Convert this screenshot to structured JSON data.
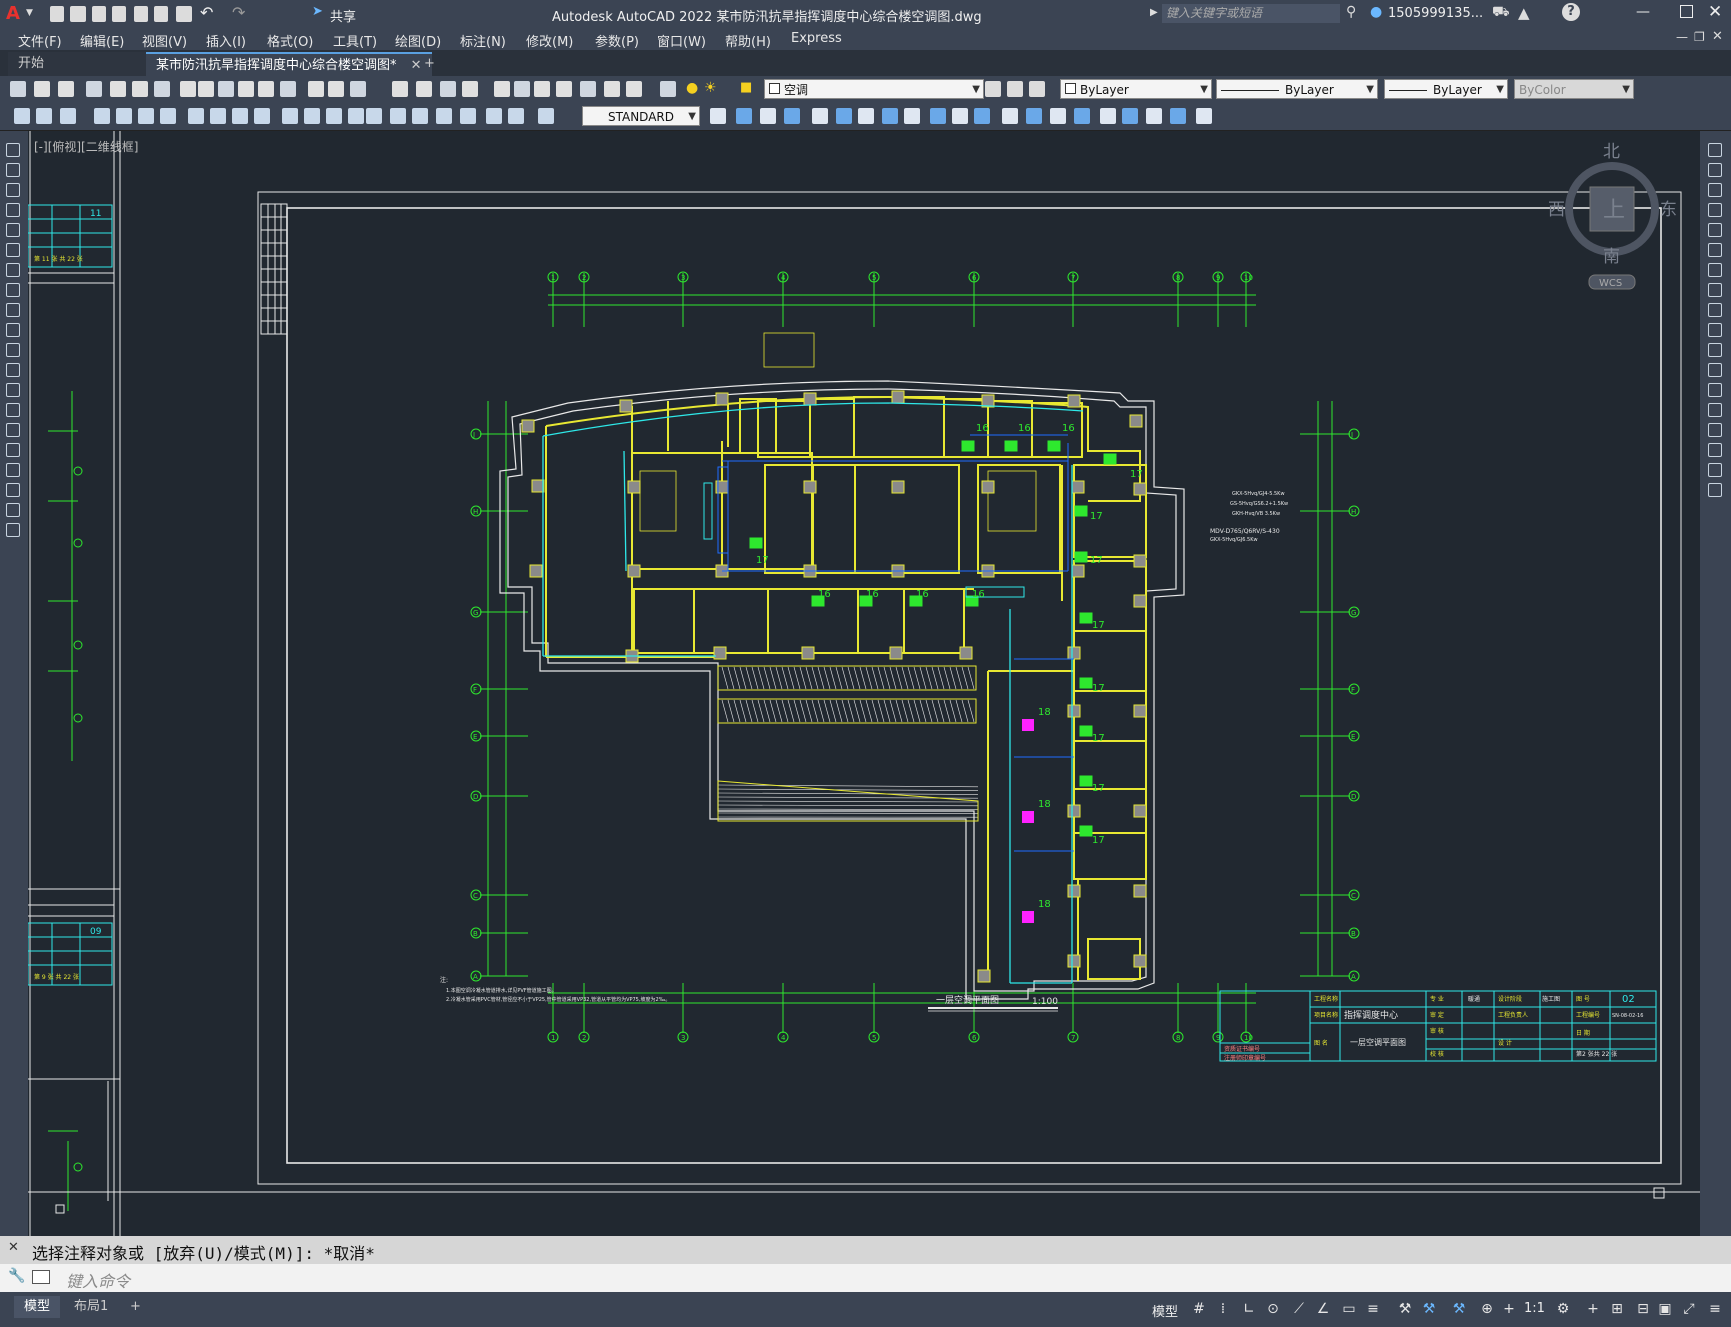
{
  "app": {
    "title": "Autodesk AutoCAD 2022    某市防汛抗旱指挥调度中心综合楼空调图.dwg",
    "share_label": "共享",
    "search_placeholder": "键入关键字或短语",
    "user": "1505999135..."
  },
  "menu": [
    "文件(F)",
    "编辑(E)",
    "视图(V)",
    "插入(I)",
    "格式(O)",
    "工具(T)",
    "绘图(D)",
    "标注(N)",
    "修改(M)",
    "参数(P)",
    "窗口(W)",
    "帮助(H)",
    "Express"
  ],
  "tabs": {
    "start": "开始",
    "active": "某市防汛抗旱指挥调度中心综合楼空调图*",
    "add": "+"
  },
  "toolbar": {
    "layer": "空调",
    "color": "ByLayer",
    "linetype": "ByLayer",
    "lineweight": "ByLayer",
    "plotstyle": "ByColor",
    "textstyle": "STANDARD"
  },
  "viewport_label": "[-][俯视][二维线框]",
  "viewcube": {
    "north": "北",
    "south": "南",
    "east": "东",
    "west": "西",
    "top": "上",
    "wcs": "WCS"
  },
  "drawing": {
    "plan_title": "一层空调平面图",
    "plan_scale": "1:100",
    "notes_title": "注:",
    "note1": "1.本图空调冷凝水管道排水,详见PVF管道施工图。",
    "note2": "2.冷凝水管采用PVC管材,管径应不小于VP25,管中管道采用VP32,管道从平管均为VP75,坡度为2‰。",
    "equipment1": "GKX-5Hvq/GJ4-5.5Kw",
    "equipment2": "GS-5Hvq/GS6.2+1.5Kw",
    "equipment3": "GKH-Hvq/VB 3.5Kw",
    "equipment4": "MDV-D765/Q6RV/S-430",
    "equipment5": "GKX-5Hvq/GJ6.5Kw",
    "grid_cols": [
      "1",
      "2",
      "3",
      "4",
      "5",
      "6",
      "7",
      "8",
      "9",
      "10"
    ],
    "grid_rows": [
      "J",
      "H",
      "G",
      "F",
      "E",
      "D",
      "C",
      "B",
      "A"
    ],
    "tags": [
      "16",
      "16",
      "16",
      "17",
      "17",
      "17",
      "17",
      "17",
      "17",
      "17",
      "17",
      "17",
      "18",
      "18",
      "18",
      "16",
      "16",
      "16",
      "16"
    ]
  },
  "title_block": {
    "project_label": "工程名称",
    "project_sub_label": "项目名称",
    "project_name": "指挥调度中心",
    "drawing_label": "图 名",
    "drawing_name": "一层空调平面图",
    "profession": "专 业",
    "profession_value": "暖通",
    "stage_label": "设计阶段",
    "stage": "施工图",
    "sheet_label": "图 号",
    "sheet": "02",
    "review": "审 定",
    "check": "审 核",
    "verify": "校 核",
    "design": "设 计",
    "leader": "工程负责人",
    "code_label": "工程编号",
    "code": "SN-08-02-16",
    "date_label": "日 期",
    "page": "第2 张共 22 张",
    "cert1": "资质证书编号",
    "cert2": "注册师印章编号"
  },
  "side_sheets": {
    "sheet_a": {
      "no": "11",
      "page": "第 11 张 共 22 张",
      "code": "SN-08-02-16"
    },
    "sheet_b": {
      "no": "09",
      "page": "第 9 张 共 22 张",
      "code": "SN-08-02-16"
    }
  },
  "command": {
    "history": "选择注释对象或 [放弃(U)/模式(M)]: *取消*",
    "placeholder": "键入命令"
  },
  "status": {
    "model_tab": "模型",
    "layout_tab": "布局1",
    "model_label": "模型",
    "scale": "1:1"
  },
  "colors": {
    "ui": "#3b4453",
    "canvas": "#212830",
    "wall": "#e8e832",
    "grid": "#2ee82e",
    "duct": "#2ee8e8",
    "pipe": "#1e6cff",
    "magenta": "#ff22ff"
  }
}
